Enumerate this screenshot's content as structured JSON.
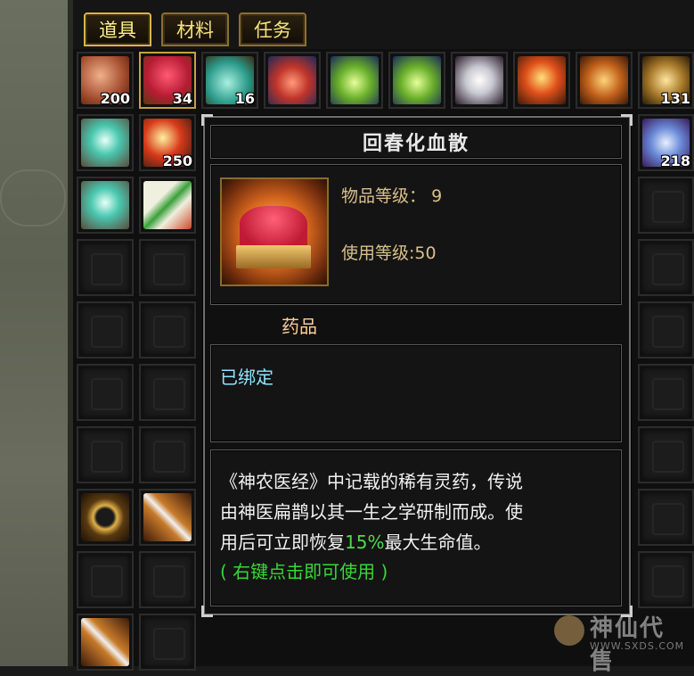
{
  "tabs": [
    {
      "label": "道具",
      "active": true
    },
    {
      "label": "材料",
      "active": false
    },
    {
      "label": "任务",
      "active": false
    }
  ],
  "inventory": {
    "row1": [
      {
        "icon": "ham-meat-icon",
        "count": "200"
      },
      {
        "icon": "red-powder-tray-icon",
        "count": "34"
      },
      {
        "icon": "teal-gourd-flask-icon",
        "count": "16"
      },
      {
        "icon": "fire-doll-icon",
        "count": ""
      },
      {
        "icon": "green-spirit-icon",
        "count": ""
      },
      {
        "icon": "green-spirit-candle-icon",
        "count": ""
      },
      {
        "icon": "white-vase-icon",
        "count": ""
      },
      {
        "icon": "fire-orb-icon",
        "count": ""
      },
      {
        "icon": "golden-box-icon",
        "count": ""
      },
      {
        "icon": "golden-scroll-icon",
        "count": "131"
      }
    ],
    "side_counts": {
      "seashell_orb_count": "",
      "red_orbs_count": "250",
      "blue_figure_count": "218"
    }
  },
  "tooltip": {
    "name": "回春化血散",
    "item_level_label": "物品等级",
    "item_level_value": "9",
    "use_level_label": "使用等级",
    "use_level_value": "50",
    "category": "药品",
    "bind_status": "已绑定",
    "description_parts": [
      "《神农医经》中记载的稀有灵药，传说",
      "由神医扁鹊以其一生之学研制而成。使",
      "用后可立即恢复",
      "15%",
      "最大生命值。"
    ],
    "usage_hint": "( 右键点击即可使用 )"
  },
  "watermark": {
    "text": "神仙代售",
    "url": "WWW.SXDS.COM"
  },
  "colors": {
    "tab_text": "#f5e27a",
    "bound_text": "#8fe6ff",
    "highlight": "#4ddc4d",
    "hint": "#36d836",
    "label": "#d7c08a"
  }
}
